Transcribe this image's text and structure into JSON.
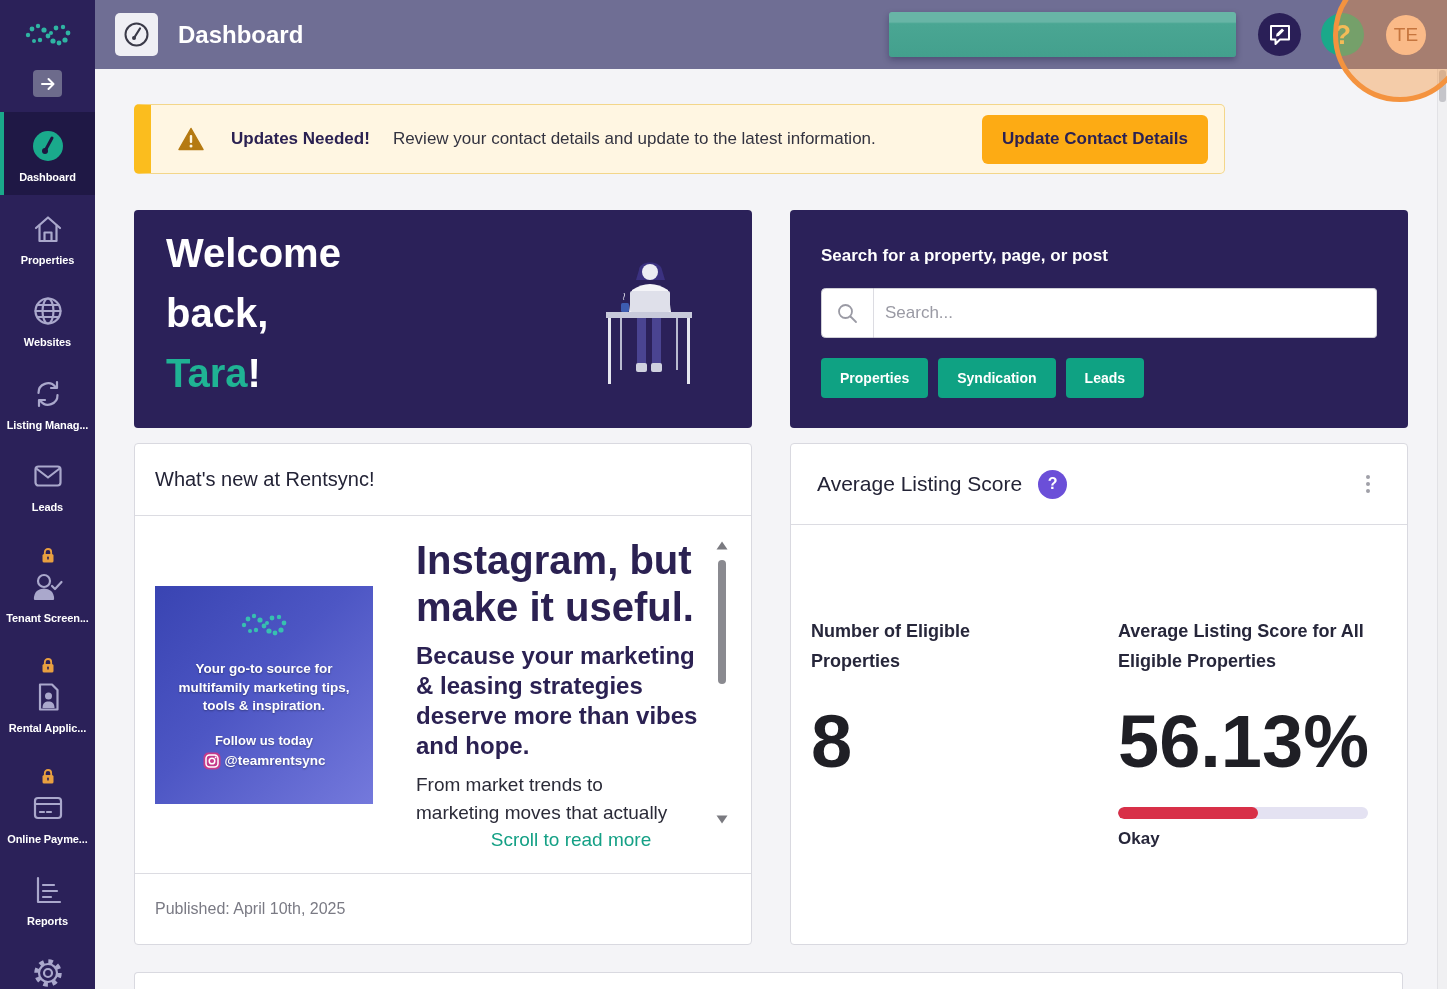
{
  "sidebar": {
    "items": [
      {
        "label": "Dashboard",
        "selected": true,
        "locked": false
      },
      {
        "label": "Properties",
        "selected": false,
        "locked": false
      },
      {
        "label": "Websites",
        "selected": false,
        "locked": false
      },
      {
        "label": "Listing Manag...",
        "selected": false,
        "locked": false
      },
      {
        "label": "Leads",
        "selected": false,
        "locked": false
      },
      {
        "label": "Tenant Screen...",
        "selected": false,
        "locked": true
      },
      {
        "label": "Rental Applic...",
        "selected": false,
        "locked": true
      },
      {
        "label": "Online Payme...",
        "selected": false,
        "locked": true
      },
      {
        "label": "Reports",
        "selected": false,
        "locked": false
      },
      {
        "selected": false,
        "locked": false
      }
    ]
  },
  "header": {
    "title": "Dashboard",
    "help": "?",
    "avatar_initials": "TE"
  },
  "alert": {
    "title": "Updates Needed!",
    "message": "Review your contact details and update to the latest information.",
    "button": "Update Contact Details"
  },
  "welcome": {
    "greeting": "Welcome back,",
    "name": "Tara",
    "suffix": "!"
  },
  "search": {
    "label": "Search for a property, page, or post",
    "placeholder": "Search...",
    "filters": [
      "Properties",
      "Syndication",
      "Leads"
    ]
  },
  "whats_new": {
    "title": "What's new at Rentsync!",
    "image": {
      "text": "Your go-to source for multifamily marketing tips, tools & inspiration.",
      "cta": "Follow us today",
      "handle": "@teamrentsync"
    },
    "headline": "Instagram, but make it useful.",
    "subheadline": "Because your marketing & leasing strategies deserve more than vibes and hope.",
    "body": "From market trends to marketing moves that actually",
    "scroll_hint": "Scroll to read more",
    "published": "Published: April 10th, 2025"
  },
  "listing_score": {
    "title": "Average Listing Score",
    "help": "?",
    "stats": [
      {
        "kind": "count",
        "label": "Number of Eligible Properties",
        "value": "8"
      },
      {
        "kind": "score",
        "label": "Average Listing Score for All Eligible Properties",
        "value": "56.13%",
        "level": 0.5613,
        "rating": "Okay"
      }
    ]
  }
}
